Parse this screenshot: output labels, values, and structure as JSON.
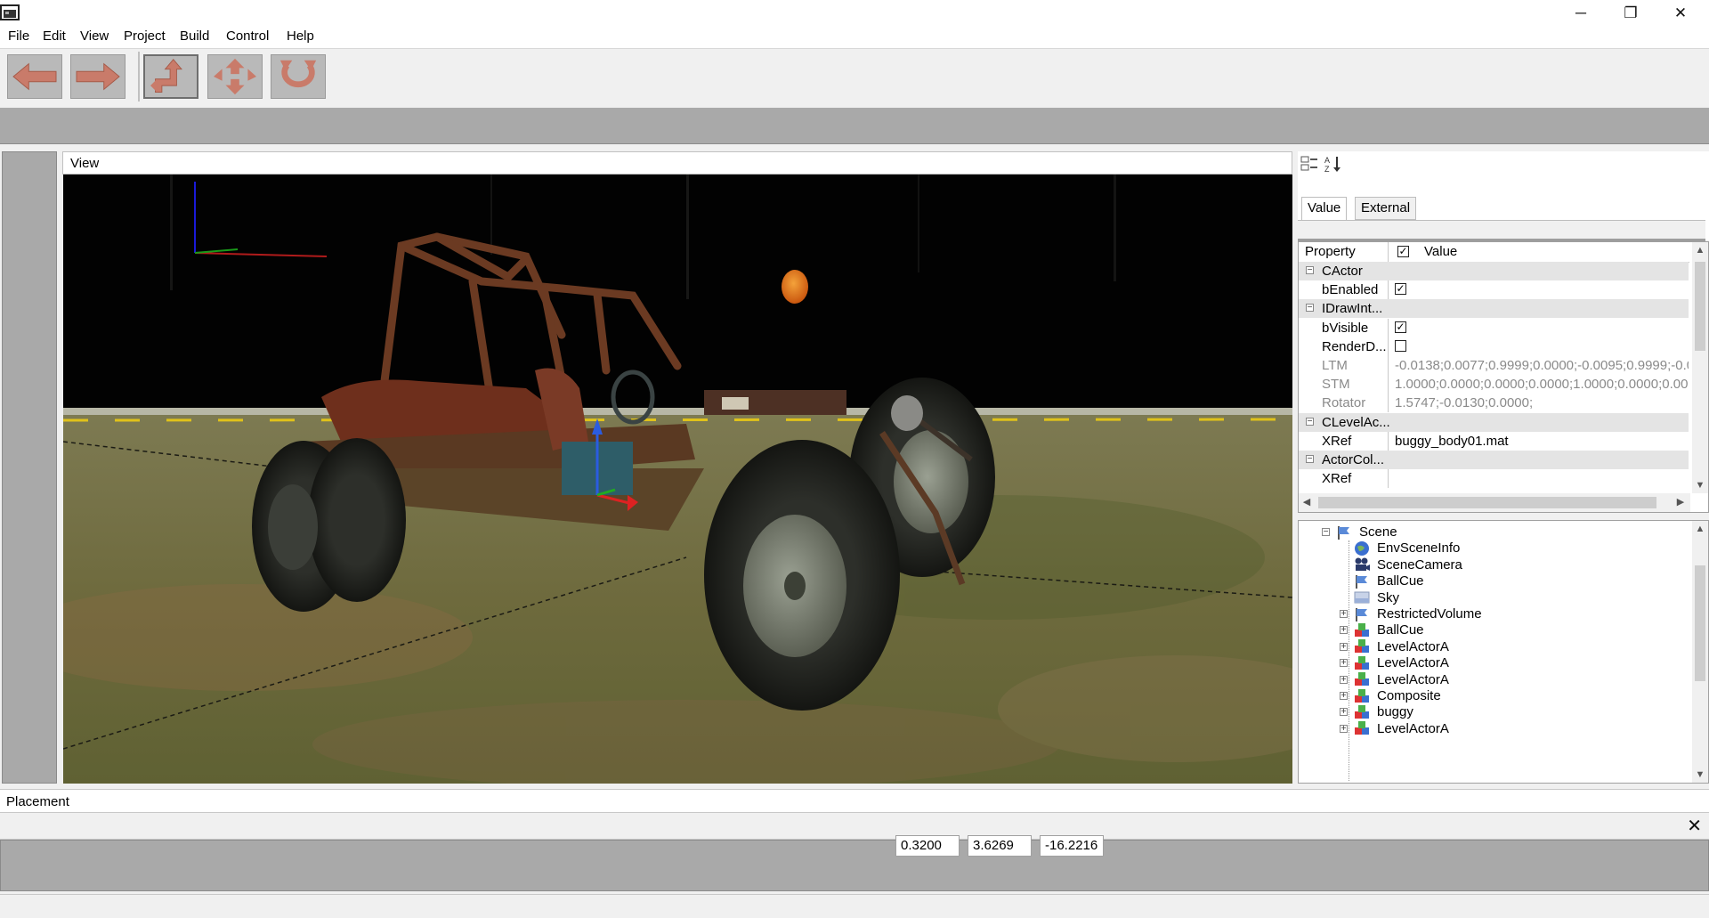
{
  "window": {
    "icon": "app-icon",
    "controls": {
      "minimize": "─",
      "maximize": "❐",
      "close": "✕"
    }
  },
  "menu": [
    "File",
    "Edit",
    "View",
    "Project",
    "Build",
    "Control",
    "Help"
  ],
  "toolbar": {
    "buttons": [
      {
        "name": "back-arrow-icon"
      },
      {
        "name": "forward-arrow-icon"
      },
      {
        "name": "move-tool-icon"
      },
      {
        "name": "scale-tool-icon"
      },
      {
        "name": "rotate-tool-icon"
      }
    ]
  },
  "view": {
    "title": "View"
  },
  "properties": {
    "toolbar_icons": [
      "categorized-icon",
      "sort-alpha-icon"
    ],
    "tabs": [
      "Value",
      "External"
    ],
    "header": {
      "property": "Property",
      "value": "Value",
      "checked": true
    },
    "rows": [
      {
        "type": "category",
        "name": "CActor"
      },
      {
        "type": "check",
        "name": "bEnabled",
        "checked": true
      },
      {
        "type": "category",
        "name": "IDrawInt..."
      },
      {
        "type": "check",
        "name": "bVisible",
        "checked": true
      },
      {
        "type": "check",
        "name": "RenderD...",
        "checked": false
      },
      {
        "type": "text",
        "name": "LTM",
        "value": "-0.0138;0.0077;0.9999;0.0000;-0.0095;0.9999;-0.00...",
        "dim": true
      },
      {
        "type": "text",
        "name": "STM",
        "value": "1.0000;0.0000;0.0000;0.0000;1.0000;0.0000;0.0000;...",
        "dim": true
      },
      {
        "type": "text",
        "name": "Rotator",
        "value": "1.5747;-0.0130;0.0000;",
        "dim": true
      },
      {
        "type": "category",
        "name": "CLevelAc..."
      },
      {
        "type": "text",
        "name": "XRef",
        "value": "buggy_body01.mat",
        "dim": false
      },
      {
        "type": "category",
        "name": "ActorCol..."
      },
      {
        "type": "text",
        "name": "XRef",
        "value": "",
        "dim": false
      }
    ]
  },
  "tree": {
    "root": "Scene",
    "children": [
      {
        "label": "EnvSceneInfo",
        "icon": "globe-icon",
        "expandable": false
      },
      {
        "label": "SceneCamera",
        "icon": "camera-icon",
        "expandable": false
      },
      {
        "label": "BallCue",
        "icon": "flag-icon",
        "expandable": false
      },
      {
        "label": "Sky",
        "icon": "sky-icon",
        "expandable": false
      },
      {
        "label": "RestrictedVolume",
        "icon": "flag-icon",
        "expandable": true
      },
      {
        "label": "BallCue",
        "icon": "actor-icon",
        "expandable": true
      },
      {
        "label": "LevelActorA",
        "icon": "actor-icon",
        "expandable": true
      },
      {
        "label": "LevelActorA",
        "icon": "actor-icon",
        "expandable": true
      },
      {
        "label": "LevelActorA",
        "icon": "actor-icon",
        "expandable": true
      },
      {
        "label": "Composite",
        "icon": "actor-icon",
        "expandable": true
      },
      {
        "label": "buggy",
        "icon": "actor-icon",
        "expandable": true
      },
      {
        "label": "LevelActorA",
        "icon": "actor-icon",
        "expandable": true
      }
    ]
  },
  "placement": {
    "title": "Placement",
    "close": "✕",
    "coords": [
      "0.3200",
      "3.6269",
      "-16.2216"
    ]
  },
  "colors": {
    "panel_gray": "#a9a9a9",
    "viewport_sky": "#000000",
    "ground": "#6f6a3e",
    "rust": "#6b3a22",
    "moon": "#e27a1c"
  }
}
